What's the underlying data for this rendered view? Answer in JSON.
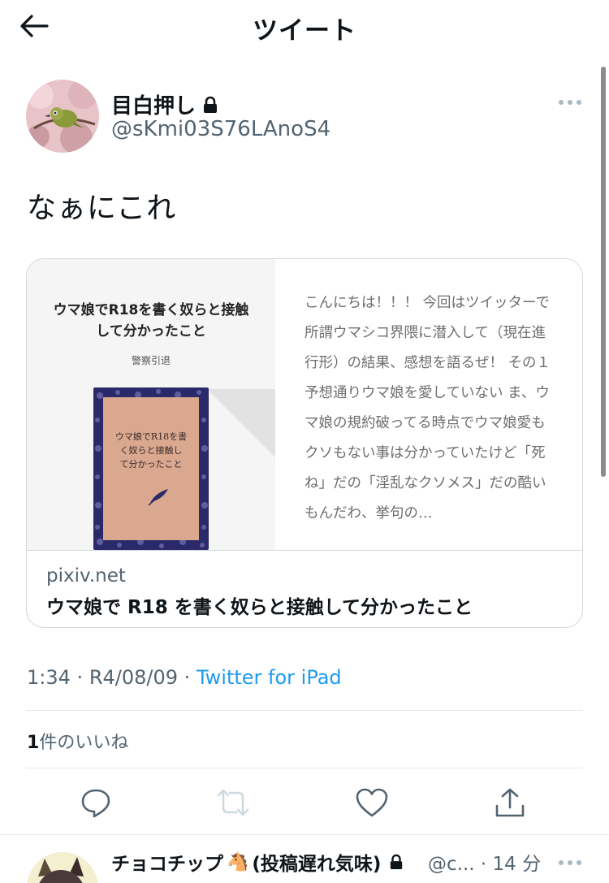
{
  "header": {
    "title": "ツイート"
  },
  "tweet": {
    "display_name": "目白押し",
    "handle": "@sKmi03S76LAnoS4",
    "text": "なぁにこれ",
    "card": {
      "cover_title_line1": "ウマ娘でR18を書く奴らと接触",
      "cover_title_line2": "して分かったこと",
      "cover_author": "警察引退",
      "book_text_line1": "ウマ娘でR18を書",
      "book_text_line2": "く奴らと接触し",
      "book_text_line3": "て分かったこと",
      "excerpt": "こんにちは！！！ 今回はツイッターで所謂ウマシコ界隈に潜入して（現在進行形）の結果、感想を語るぜ！ その１ 予想通りウマ娘を愛していない ま、ウマ娘の規約破ってる時点でウマ娘愛もクソもない事は分かっていたけど「死ね」だの「淫乱なクソメス」だの酷いもんだわ、挙句の…",
      "domain": "pixiv.net",
      "title": "ウマ娘で R18 を書く奴らと接触して分かったこと"
    },
    "time": "1:34",
    "date": "R4/08/09",
    "separator": "·",
    "source": "Twitter for iPad",
    "likes_count": "1",
    "likes_label": "件のいいね"
  },
  "next_tweet": {
    "display_name": "チョコチップ",
    "display_name_suffix": "(投稿遅れ気味)",
    "handle": "@c...",
    "time": "· 14 分"
  },
  "icons": [
    "back-arrow-icon",
    "lock-icon",
    "more-icon",
    "reply-icon",
    "retweet-icon",
    "like-icon",
    "share-icon",
    "horse-emoji-icon"
  ],
  "colors": {
    "link": "#1d9bf0",
    "secondary_text": "#536471",
    "border": "#cfd9de",
    "retweet_disabled": "#cfd9de"
  }
}
